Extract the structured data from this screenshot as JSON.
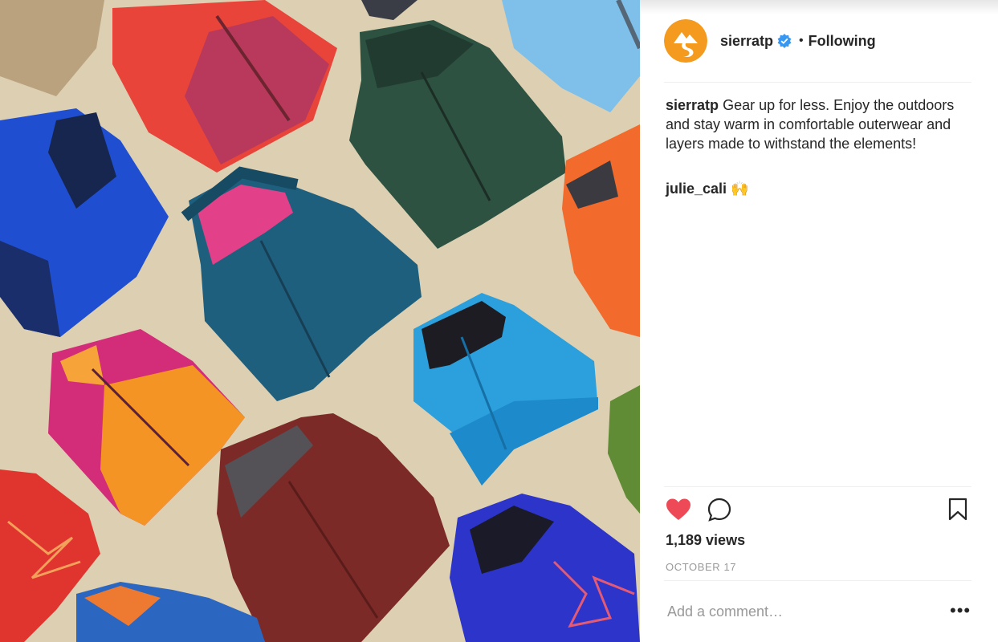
{
  "post": {
    "username": "sierratp",
    "separator": "•",
    "follow_status": "Following",
    "caption_username": "sierratp",
    "caption_text": "Gear up for less. Enjoy the outdoors and stay warm in comfortable outerwear and layers made to withstand the elements!",
    "comments": [
      {
        "username": "julie_cali",
        "text": "🙌"
      }
    ],
    "views": "1,189 views",
    "date": "OCTOBER 17",
    "comment_placeholder": "Add a comment…",
    "more_label": "•••",
    "liked": true
  },
  "colors": {
    "brand_orange": "#f39a1f",
    "verified_blue": "#3897f0",
    "like_red": "#ed4956",
    "text": "#262626",
    "muted": "#999999"
  },
  "icons": [
    "sierra-logo-icon",
    "verified-badge-icon",
    "heart-icon",
    "comment-icon",
    "bookmark-icon",
    "more-options-icon"
  ]
}
